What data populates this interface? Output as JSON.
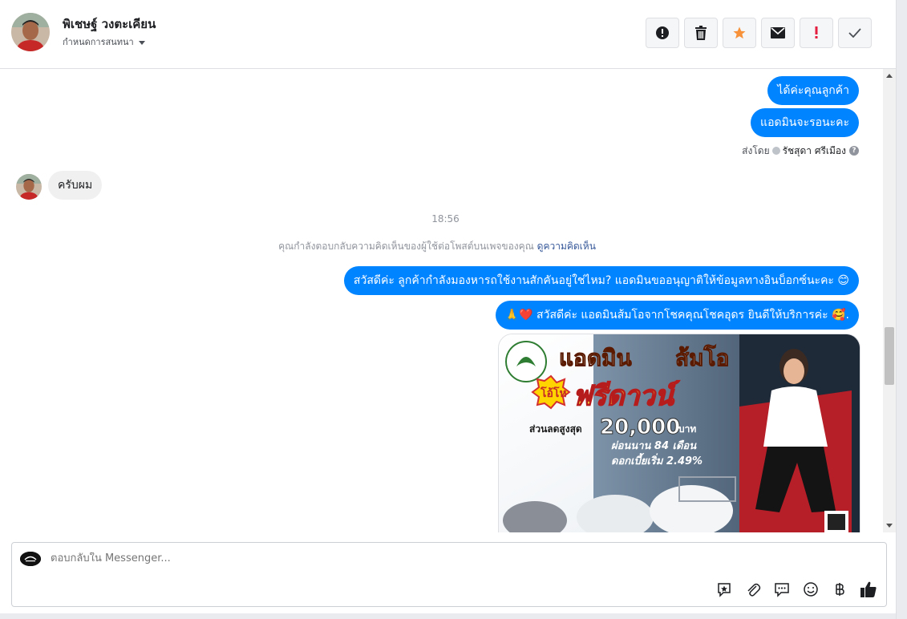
{
  "header": {
    "name": "พิเชษฐ์ วงตะเคียน",
    "subtitle": "กำหนดการสนทนา",
    "actions": [
      {
        "icon": "alert-circle-icon"
      },
      {
        "icon": "trash-icon"
      },
      {
        "icon": "star-icon",
        "color": "#f7923b"
      },
      {
        "icon": "envelope-icon"
      },
      {
        "icon": "exclamation-icon",
        "color": "#e41e3f"
      },
      {
        "icon": "check-icon"
      }
    ]
  },
  "messages": {
    "out1": "ได้ค่ะคุณลูกค้า",
    "out2": "แอดมินจะรอนะคะ",
    "sent_by_prefix": "ส่งโดย",
    "sent_by_name": "รัชสุดา ศรีเมือง",
    "in1": "ครับผม",
    "time": "18:56",
    "notice_text": "คุณกำลังตอบกลับความคิดเห็นของผู้ใช้ต่อโพสต์บนเพจของคุณ",
    "notice_link": "ดูความคิดเห็น",
    "out3": "สวัสดีค่ะ ลูกค้ากำลังมองหารถใช้งานสักคันอยู่ใช่ไหม? แอดมินขออนุญาติให้ข้อมูลทางอินบ็อกซ์นะคะ 😊",
    "out4": "🙏❤️ สวัสดีค่ะ แอดมินส้มโอจากโชคคุณโชคอุดร ยินดีให้บริการค่ะ 🥰."
  },
  "ad": {
    "title1": "แอดมิน",
    "title2": "ส้มโอ",
    "badge": "โอ้โห",
    "headline": "ฟรีดาวน์",
    "discount_label": "ส่วนลดสูงสุด",
    "discount_value": "20,000",
    "discount_unit": "บาท",
    "installment": "ผ่อนนาน 84 เดือน",
    "interest": "ดอกเบี้ยเริ่ม 2.49%"
  },
  "composer": {
    "placeholder": "ตอบกลับใน Messenger...",
    "tools": [
      "sticker-reply-icon",
      "attachment-icon",
      "saved-reply-icon",
      "emoji-icon",
      "baht-icon",
      "thumbs-up-icon"
    ]
  },
  "colors": {
    "accent": "#0084ff",
    "star": "#f7923b",
    "red": "#e41e3f"
  }
}
